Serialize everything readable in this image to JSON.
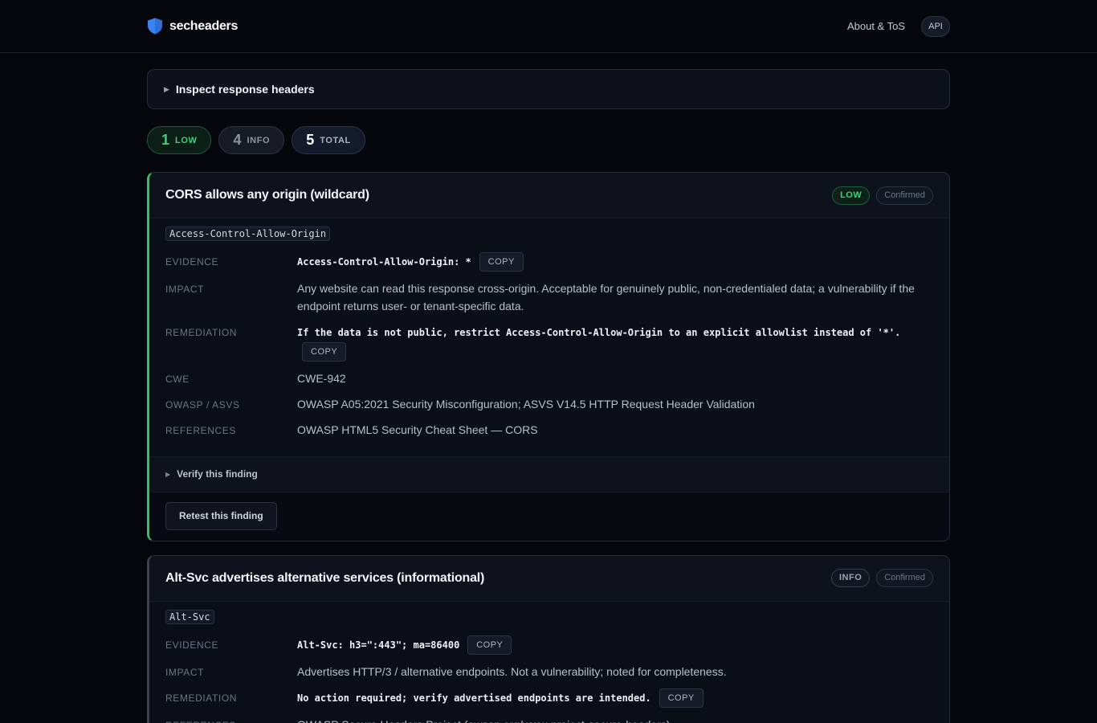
{
  "brand": {
    "name": "secheaders",
    "accent": "#3b82f6"
  },
  "nav": {
    "about_label": "About & ToS",
    "api_label": "API"
  },
  "inspect": {
    "label": "Inspect response headers"
  },
  "counts": [
    {
      "num": "1",
      "label": "LOW"
    },
    {
      "num": "4",
      "label": "INFO"
    },
    {
      "num": "5",
      "label": "TOTAL"
    }
  ],
  "labels": {
    "evidence": "EVIDENCE",
    "impact": "IMPACT",
    "remediation": "REMEDIATION",
    "cwe": "CWE",
    "owasp": "OWASP / ASVS",
    "references": "REFERENCES",
    "copy": "COPY",
    "verify": "Verify this finding",
    "retest": "Retest this finding"
  },
  "findings": [
    {
      "title": "CORS allows any origin (wildcard)",
      "severity": "LOW",
      "status": "Confirmed",
      "header": "Access-Control-Allow-Origin",
      "evidence": "Access-Control-Allow-Origin: *",
      "impact": "Any website can read this response cross-origin. Acceptable for genuinely public, non-credentialed data; a vulnerability if the endpoint returns user- or tenant-specific data.",
      "remediation": "If the data is not public, restrict Access-Control-Allow-Origin to an explicit allowlist instead of '*'.",
      "cwe": "CWE-942",
      "owasp": "OWASP A05:2021 Security Misconfiguration; ASVS V14.5 HTTP Request Header Validation",
      "references": "OWASP HTML5 Security Cheat Sheet — CORS"
    },
    {
      "title": "Alt-Svc advertises alternative services (informational)",
      "severity": "INFO",
      "status": "Confirmed",
      "header": "Alt-Svc",
      "evidence": "Alt-Svc: h3=\":443\"; ma=86400",
      "impact": "Advertises HTTP/3 / alternative endpoints. Not a vulnerability; noted for completeness.",
      "remediation": "No action required; verify advertised endpoints are intended.",
      "references": "OWASP Secure Headers Project (owasp.org/www-project-secure-headers)"
    }
  ]
}
